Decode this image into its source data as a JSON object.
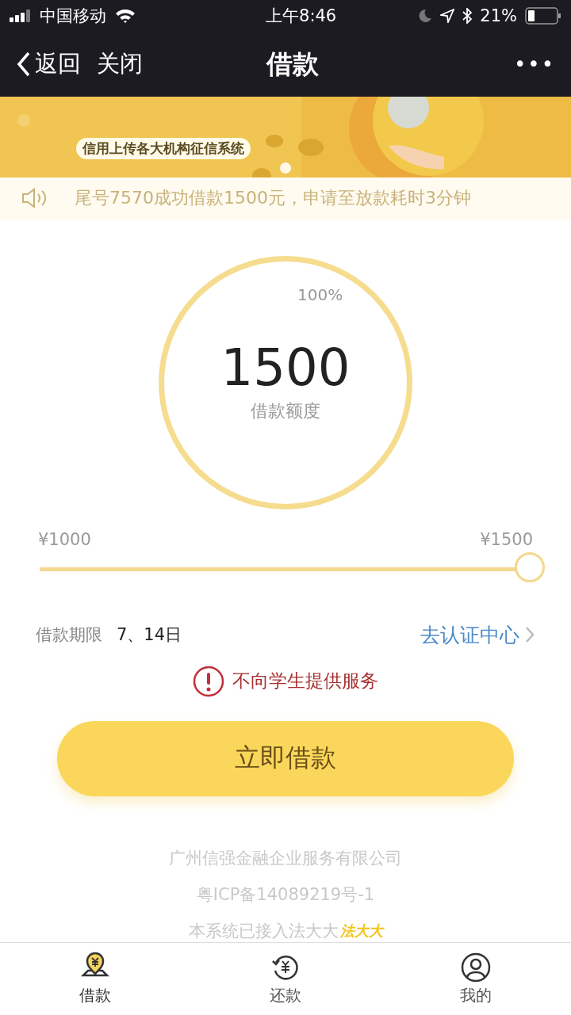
{
  "status_bar": {
    "carrier": "中国移动",
    "time": "上午8:46",
    "battery": "21%"
  },
  "nav": {
    "back": "返回",
    "close": "关闭",
    "title": "借款",
    "more": "•••"
  },
  "banner": {
    "kind": "picture",
    "caption": "信用上传各大机构征信系统"
  },
  "notice": "尾号7570成功借款1500元，申请至放款耗时3分钟",
  "quota": {
    "percent": "100%",
    "amount": "1500",
    "label": "借款额度"
  },
  "slider": {
    "min_label": "¥1000",
    "max_label": "¥1500",
    "level": 1
  },
  "term": {
    "label": "借款期限",
    "value": "7、14日",
    "link": "去认证中心"
  },
  "warning": "不向学生提供服务",
  "submit": "立即借款",
  "footer": {
    "company": "广州信强金融企业服务有限公司",
    "icp": "粤ICP备14089219号-1",
    "system": "本系统已接入法大大",
    "logo_text": "法大大"
  },
  "tabs": [
    {
      "label": "借款",
      "kind": "borrow",
      "selected": true
    },
    {
      "label": "还款",
      "kind": "repay",
      "selected": false
    },
    {
      "label": "我的",
      "kind": "me",
      "selected": false
    }
  ]
}
